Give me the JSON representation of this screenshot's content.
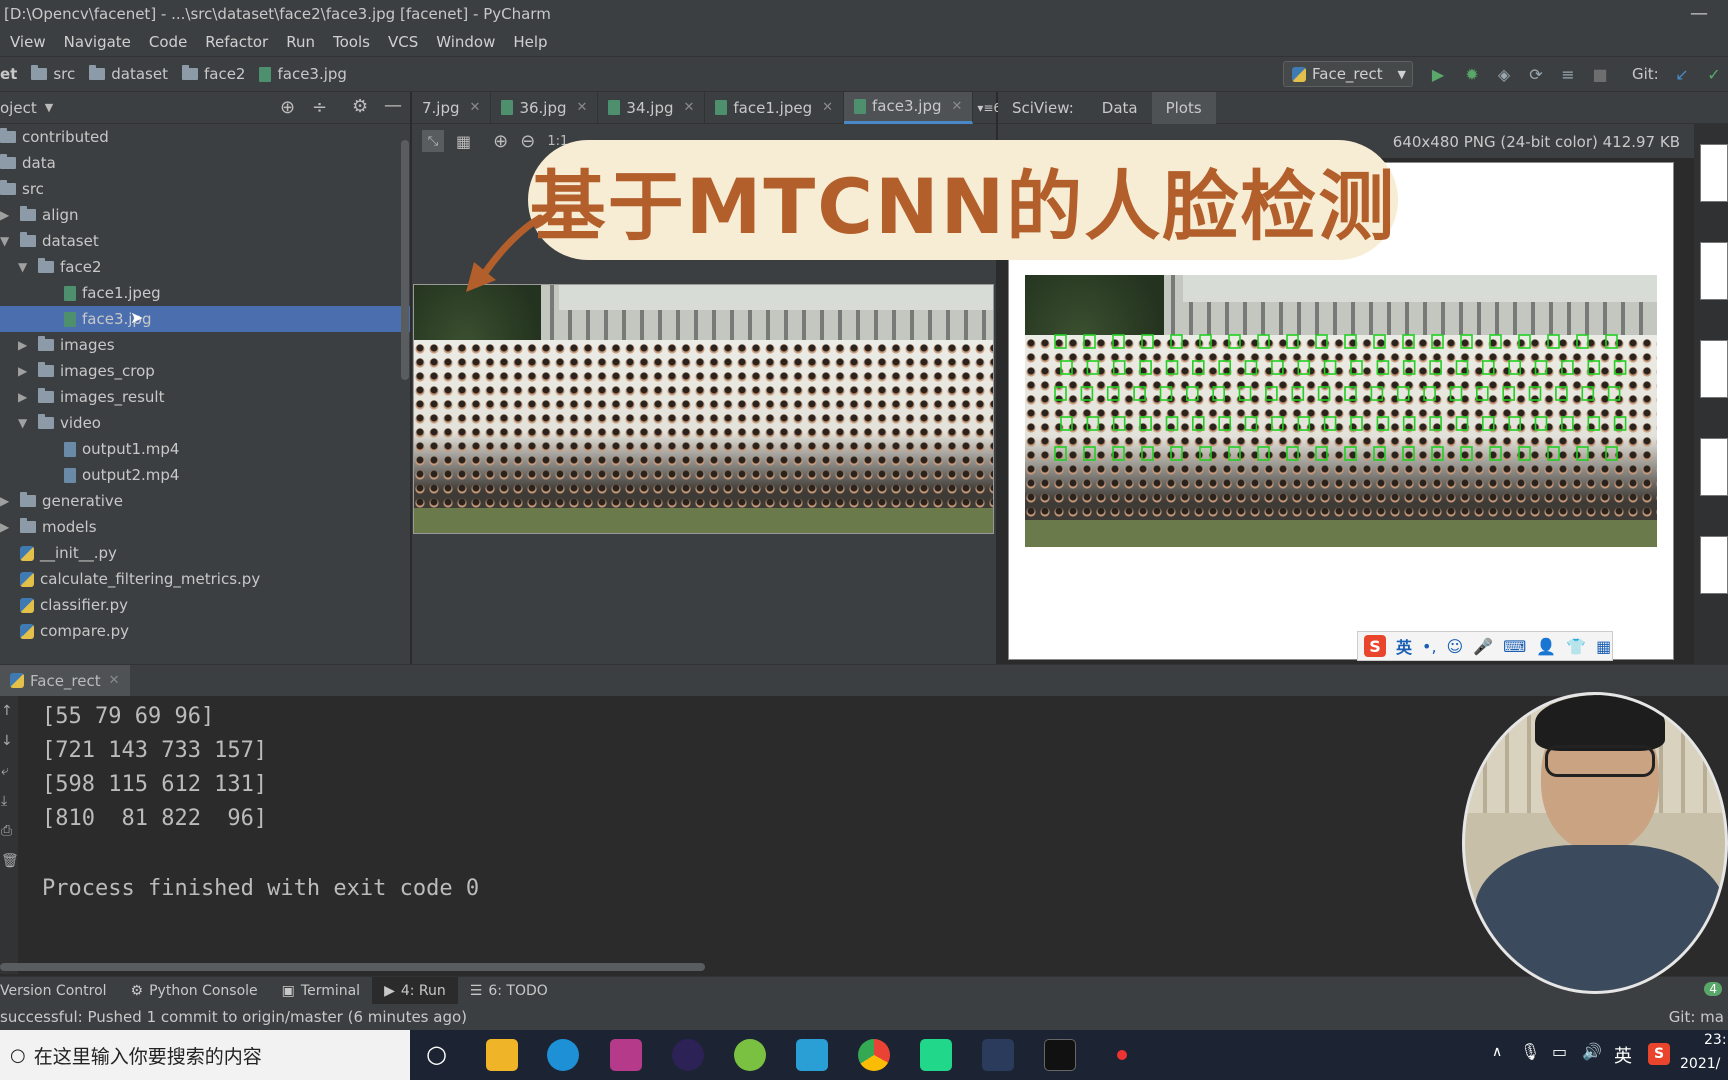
{
  "window": {
    "title": "[D:\\Opencv\\facenet] - ...\\src\\dataset\\face2\\face3.jpg [facenet] - PyCharm"
  },
  "menu": [
    "View",
    "Navigate",
    "Code",
    "Refactor",
    "Run",
    "Tools",
    "VCS",
    "Window",
    "Help"
  ],
  "breadcrumb": {
    "root": "et",
    "items": [
      "src",
      "dataset",
      "face2",
      "face3.jpg"
    ]
  },
  "run_config": "Face_rect",
  "git_label": "Git:",
  "project": {
    "header": "oject",
    "tree": [
      {
        "label": "contributed",
        "depth": 0,
        "kind": "folder",
        "arrow": ""
      },
      {
        "label": "data",
        "depth": 0,
        "kind": "folder",
        "arrow": ""
      },
      {
        "label": "src",
        "depth": 0,
        "kind": "folder",
        "arrow": ""
      },
      {
        "label": "align",
        "depth": 1,
        "kind": "folder",
        "arrow": "right"
      },
      {
        "label": "dataset",
        "depth": 1,
        "kind": "folder",
        "arrow": "down"
      },
      {
        "label": "face2",
        "depth": 2,
        "kind": "folder",
        "arrow": "down"
      },
      {
        "label": "face1.jpeg",
        "depth": 3,
        "kind": "image",
        "arrow": ""
      },
      {
        "label": "face3.jpg",
        "depth": 3,
        "kind": "image",
        "arrow": "",
        "selected": true
      },
      {
        "label": "images",
        "depth": 2,
        "kind": "folder",
        "arrow": "right"
      },
      {
        "label": "images_crop",
        "depth": 2,
        "kind": "folder",
        "arrow": "right"
      },
      {
        "label": "images_result",
        "depth": 2,
        "kind": "folder",
        "arrow": "right"
      },
      {
        "label": "video",
        "depth": 2,
        "kind": "folder",
        "arrow": "down"
      },
      {
        "label": "output1.mp4",
        "depth": 3,
        "kind": "video",
        "arrow": ""
      },
      {
        "label": "output2.mp4",
        "depth": 3,
        "kind": "video",
        "arrow": ""
      },
      {
        "label": "generative",
        "depth": 1,
        "kind": "folder",
        "arrow": "right"
      },
      {
        "label": "models",
        "depth": 1,
        "kind": "folder",
        "arrow": "right"
      },
      {
        "label": "__init__.py",
        "depth": 1,
        "kind": "python",
        "arrow": ""
      },
      {
        "label": "calculate_filtering_metrics.py",
        "depth": 1,
        "kind": "python",
        "arrow": ""
      },
      {
        "label": "classifier.py",
        "depth": 1,
        "kind": "python",
        "arrow": ""
      },
      {
        "label": "compare.py",
        "depth": 1,
        "kind": "python",
        "arrow": ""
      }
    ]
  },
  "editor_tabs": [
    {
      "label": "7.jpg",
      "active": false
    },
    {
      "label": "36.jpg",
      "active": false
    },
    {
      "label": "34.jpg",
      "active": false
    },
    {
      "label": "face1.jpeg",
      "active": false
    },
    {
      "label": "face3.jpg",
      "active": true
    }
  ],
  "editor_tab_overflow": "6",
  "zoom_label": "1:1",
  "sciview": {
    "label": "SciView:",
    "tabs": [
      {
        "label": "Data",
        "active": false
      },
      {
        "label": "Plots",
        "active": true
      }
    ],
    "image_info": "640x480 PNG (24-bit color) 412.97 KB"
  },
  "banner_text": "基于MTCNN的人脸检测",
  "ime_toolbar": {
    "lang": "英"
  },
  "run_panel": {
    "tab": "Face_rect",
    "lines": [
      "[55 79 69 96]",
      "[721 143 733 157]",
      "[598 115 612 131]",
      "[810  81 822  96]",
      "",
      "Process finished with exit code 0"
    ]
  },
  "tool_tabs": [
    {
      "label": "Version Control",
      "active": false
    },
    {
      "label": "Python Console",
      "active": false
    },
    {
      "label": "Terminal",
      "active": false
    },
    {
      "label": "4: Run",
      "active": true
    },
    {
      "label": "6: TODO",
      "active": false
    }
  ],
  "status": {
    "message": "successful: Pushed 1 commit to origin/master (6 minutes ago)",
    "right": "Git: ma",
    "badge": "4"
  },
  "taskbar": {
    "search_placeholder": "在这里输入你要搜索的内容",
    "tray_lang": "英",
    "time": "23:",
    "date": "2021/"
  }
}
